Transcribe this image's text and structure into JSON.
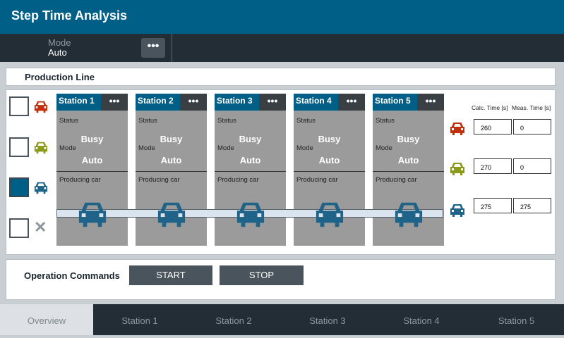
{
  "header": {
    "title": "Step Time Analysis"
  },
  "mode": {
    "label": "Mode",
    "value": "Auto",
    "menu_glyph": "•••"
  },
  "production_line": {
    "title": "Production Line",
    "car_colors": [
      "#c0300c",
      "#8c9a1c",
      "#1f6488"
    ],
    "selectors": [
      {
        "color": "#c0300c",
        "checked": false
      },
      {
        "color": "#8c9a1c",
        "checked": false
      },
      {
        "color": "#1f6488",
        "checked": true
      },
      {
        "icon": "close-icon",
        "glyph": "✕",
        "checked": false
      }
    ],
    "stations": [
      {
        "name": "Station 1",
        "menu": "•••",
        "status_label": "Status",
        "status": "Busy",
        "mode_label": "Mode",
        "mode": "Auto",
        "producing_label": "Producing car"
      },
      {
        "name": "Station 2",
        "menu": "•••",
        "status_label": "Status",
        "status": "Busy",
        "mode_label": "Mode",
        "mode": "Auto",
        "producing_label": "Producing car"
      },
      {
        "name": "Station 3",
        "menu": "•••",
        "status_label": "Status",
        "status": "Busy",
        "mode_label": "Mode",
        "mode": "Auto",
        "producing_label": "Producing car"
      },
      {
        "name": "Station 4",
        "menu": "•••",
        "status_label": "Status",
        "status": "Busy",
        "mode_label": "Mode",
        "mode": "Auto",
        "producing_label": "Producing car"
      },
      {
        "name": "Station 5",
        "menu": "•••",
        "status_label": "Status",
        "status": "Busy",
        "mode_label": "Mode",
        "mode": "Auto",
        "producing_label": "Producing car"
      }
    ],
    "times": {
      "calc_header": "Calc. Time [s]",
      "meas_header": "Meas. Time [s]",
      "rows": [
        {
          "color": "#c0300c",
          "calc": "260",
          "meas": "0"
        },
        {
          "color": "#8c9a1c",
          "calc": "270",
          "meas": "0"
        },
        {
          "color": "#1f6488",
          "calc": "275",
          "meas": "275"
        }
      ]
    }
  },
  "operations": {
    "label": "Operation Commands",
    "start": "START",
    "stop": "STOP"
  },
  "tabs": [
    "Overview",
    "Station 1",
    "Station 2",
    "Station 3",
    "Station 4",
    "Station 5"
  ]
}
